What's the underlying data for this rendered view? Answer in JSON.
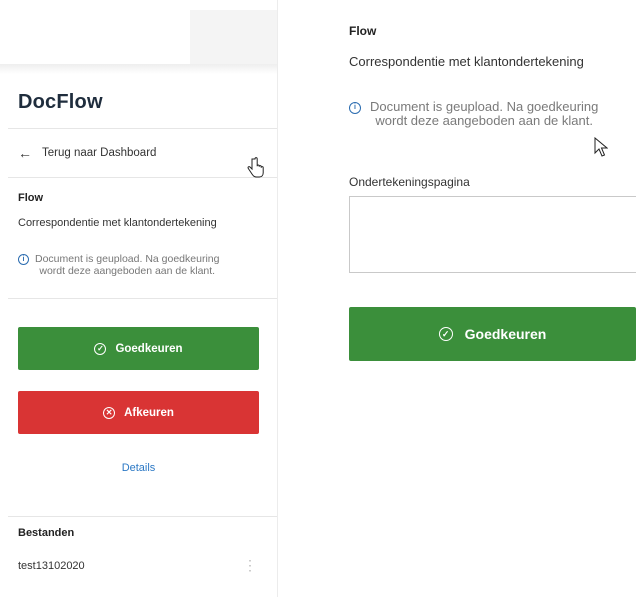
{
  "app": {
    "title": "DocFlow"
  },
  "sidebar": {
    "back_label": "Terug naar Dashboard",
    "flow_heading": "Flow",
    "flow_name": "Correspondentie met klantondertekening",
    "info_line1": "Document is geupload. Na goedkeuring",
    "info_line2": "wordt deze aangeboden aan de klant.",
    "approve_label": "Goedkeuren",
    "reject_label": "Afkeuren",
    "details_label": "Details",
    "files_heading": "Bestanden",
    "files": [
      {
        "name": "test13102020"
      }
    ]
  },
  "detail": {
    "flow_heading": "Flow",
    "flow_name": "Correspondentie met klantondertekening",
    "info_line1": "Document is geupload. Na goedkeuring",
    "info_line2": "wordt deze aangeboden aan de klant.",
    "sign_page_label": "Ondertekeningspagina",
    "sign_page_value": "",
    "approve_label": "Goedkeuren"
  },
  "icons": {
    "back": "arrow-left-icon",
    "info": "info-circle-icon",
    "approve": "check-circle-icon",
    "reject": "x-circle-icon",
    "more": "kebab-menu-icon"
  },
  "colors": {
    "approve": "#3b8f3b",
    "reject": "#d93434",
    "link": "#2b78c5",
    "info": "#2b6cb0"
  }
}
